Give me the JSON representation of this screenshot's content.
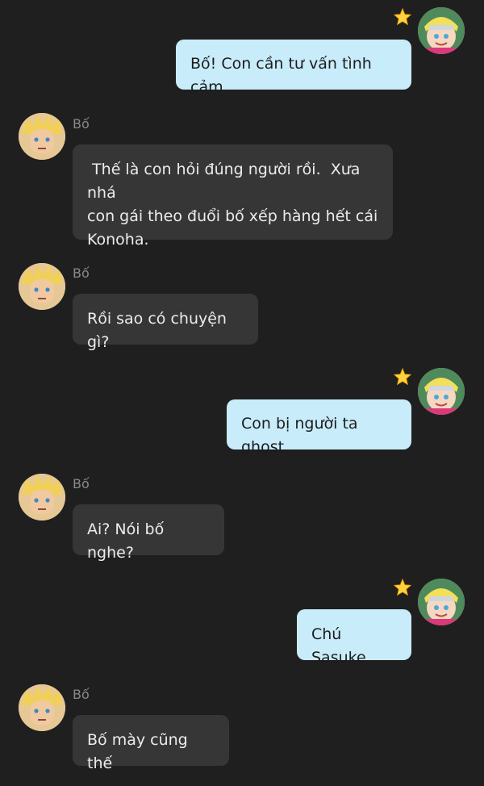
{
  "chat": {
    "messages": [
      {
        "id": "m1",
        "direction": "outgoing",
        "text": "Bố! Con cần tư vấn tình cảm."
      },
      {
        "id": "m2",
        "direction": "incoming",
        "sender": "Bố",
        "text": " Thế là con hỏi đúng người rồi.  Xưa nhá\ncon gái theo đuổi bố xếp hàng hết cái\nKonoha."
      },
      {
        "id": "m3",
        "direction": "incoming",
        "sender": "Bố",
        "text": "Rồi sao có chuyện gì?"
      },
      {
        "id": "m4",
        "direction": "outgoing",
        "text": "Con bị người ta ghost"
      },
      {
        "id": "m5",
        "direction": "incoming",
        "sender": "Bố",
        "text": "Ai? Nói bố nghe?"
      },
      {
        "id": "m6",
        "direction": "outgoing",
        "text": "Chú Sasuke"
      },
      {
        "id": "m7",
        "direction": "incoming",
        "sender": "Bố",
        "text": "Bố mày cũng thế"
      }
    ]
  },
  "icons": {
    "outgoing_avatar": "boy-avatar-icon",
    "incoming_avatar": "father-avatar-icon",
    "badge": "star-icon"
  },
  "colors": {
    "background": "#1f1f1f",
    "incoming_bubble": "#363636",
    "outgoing_bubble": "#c9ecfb",
    "sender_name": "#8a8a8a"
  }
}
